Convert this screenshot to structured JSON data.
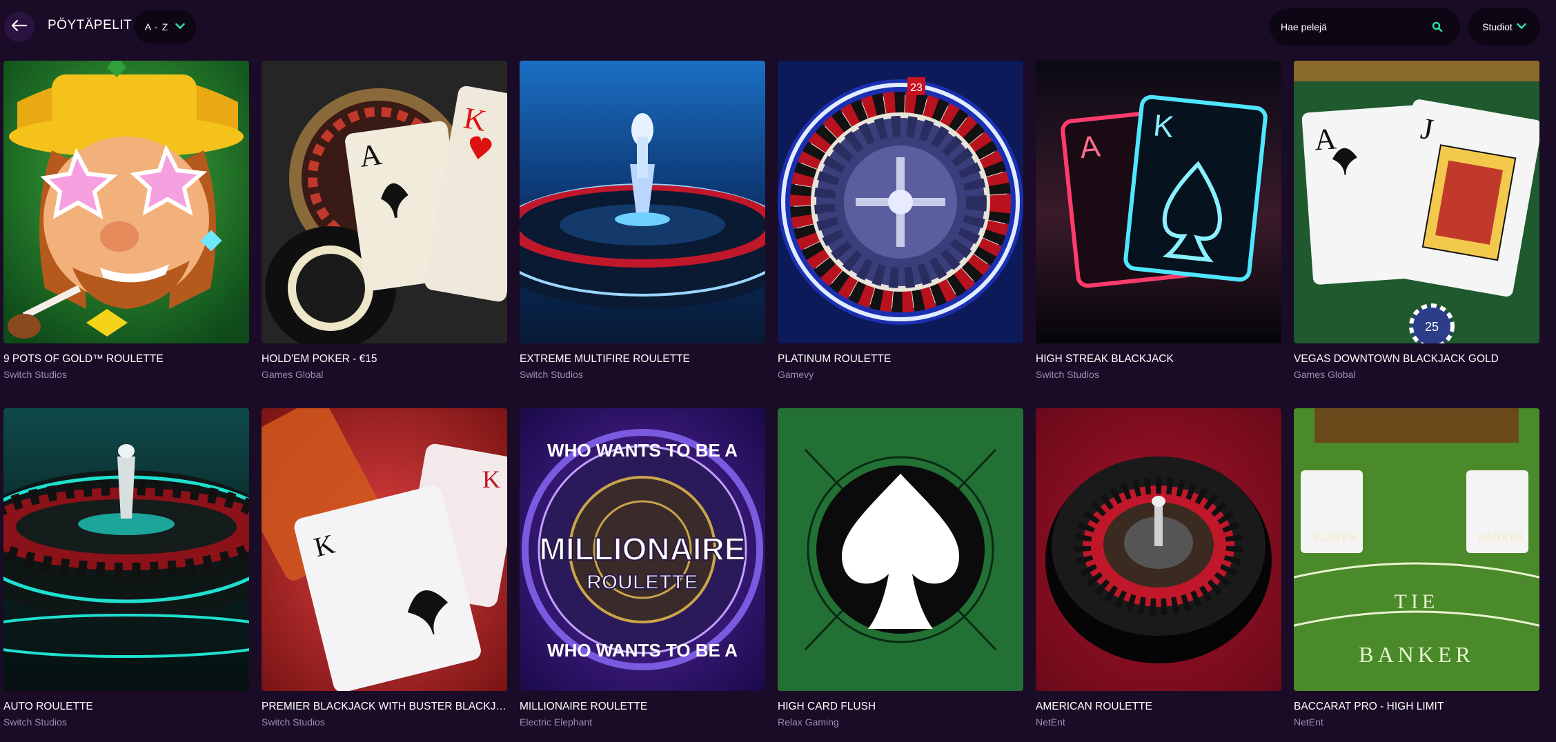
{
  "header": {
    "title": "PÖYTÄPELIT",
    "sort_label": "A - Z",
    "search_placeholder": "Hae pelejä",
    "studios_label": "Studiot"
  },
  "colors": {
    "background": "#1a0b26",
    "accent": "#34e0a1",
    "studio_text": "#9b8fb0"
  },
  "games": [
    {
      "title": "9 POTS OF GOLD™ ROULETTE",
      "studio": "Switch Studios",
      "art": "leprechaun"
    },
    {
      "title": "HOLD'EM POKER - €15",
      "studio": "Games Global",
      "art": "poker"
    },
    {
      "title": "EXTREME MULTIFIRE ROULETTE",
      "studio": "Switch Studios",
      "art": "blue-roulette"
    },
    {
      "title": "PLATINUM ROULETTE",
      "studio": "Gamevy",
      "art": "platinum-wheel"
    },
    {
      "title": "HIGH STREAK BLACKJACK",
      "studio": "Switch Studios",
      "art": "neon-cards"
    },
    {
      "title": "VEGAS DOWNTOWN BLACKJACK GOLD",
      "studio": "Games Global",
      "art": "blackjack-cards"
    },
    {
      "title": "AUTO ROULETTE",
      "studio": "Switch Studios",
      "art": "teal-roulette"
    },
    {
      "title": "PREMIER BLACKJACK WITH BUSTER BLACKJAC...",
      "studio": "Switch Studios",
      "art": "red-king"
    },
    {
      "title": "MILLIONAIRE ROULETTE",
      "studio": "Electric Elephant",
      "art": "millionaire"
    },
    {
      "title": "HIGH CARD FLUSH",
      "studio": "Relax Gaming",
      "art": "spade"
    },
    {
      "title": "AMERICAN ROULETTE",
      "studio": "NetEnt",
      "art": "american-wheel"
    },
    {
      "title": "BACCARAT PRO - HIGH LIMIT",
      "studio": "NetEnt",
      "art": "baccarat"
    }
  ],
  "art_text": {
    "millionaire_top": "WHO WANTS TO BE A",
    "millionaire_main": "MILLIONAIRE",
    "millionaire_sub": "ROULETTE",
    "poker_card_a": "A",
    "poker_card_k": "K",
    "neon_card_a": "A",
    "neon_card_k": "K",
    "bj_card_a": "A",
    "bj_card_j": "J",
    "chip_value": "25",
    "red_king_rank": "K",
    "baccarat_player": "PLAYER",
    "baccarat_banker": "BANKER",
    "baccarat_tie": "TIE",
    "baccarat_banker_big": "BANKER",
    "platinum_top_number": "23"
  }
}
